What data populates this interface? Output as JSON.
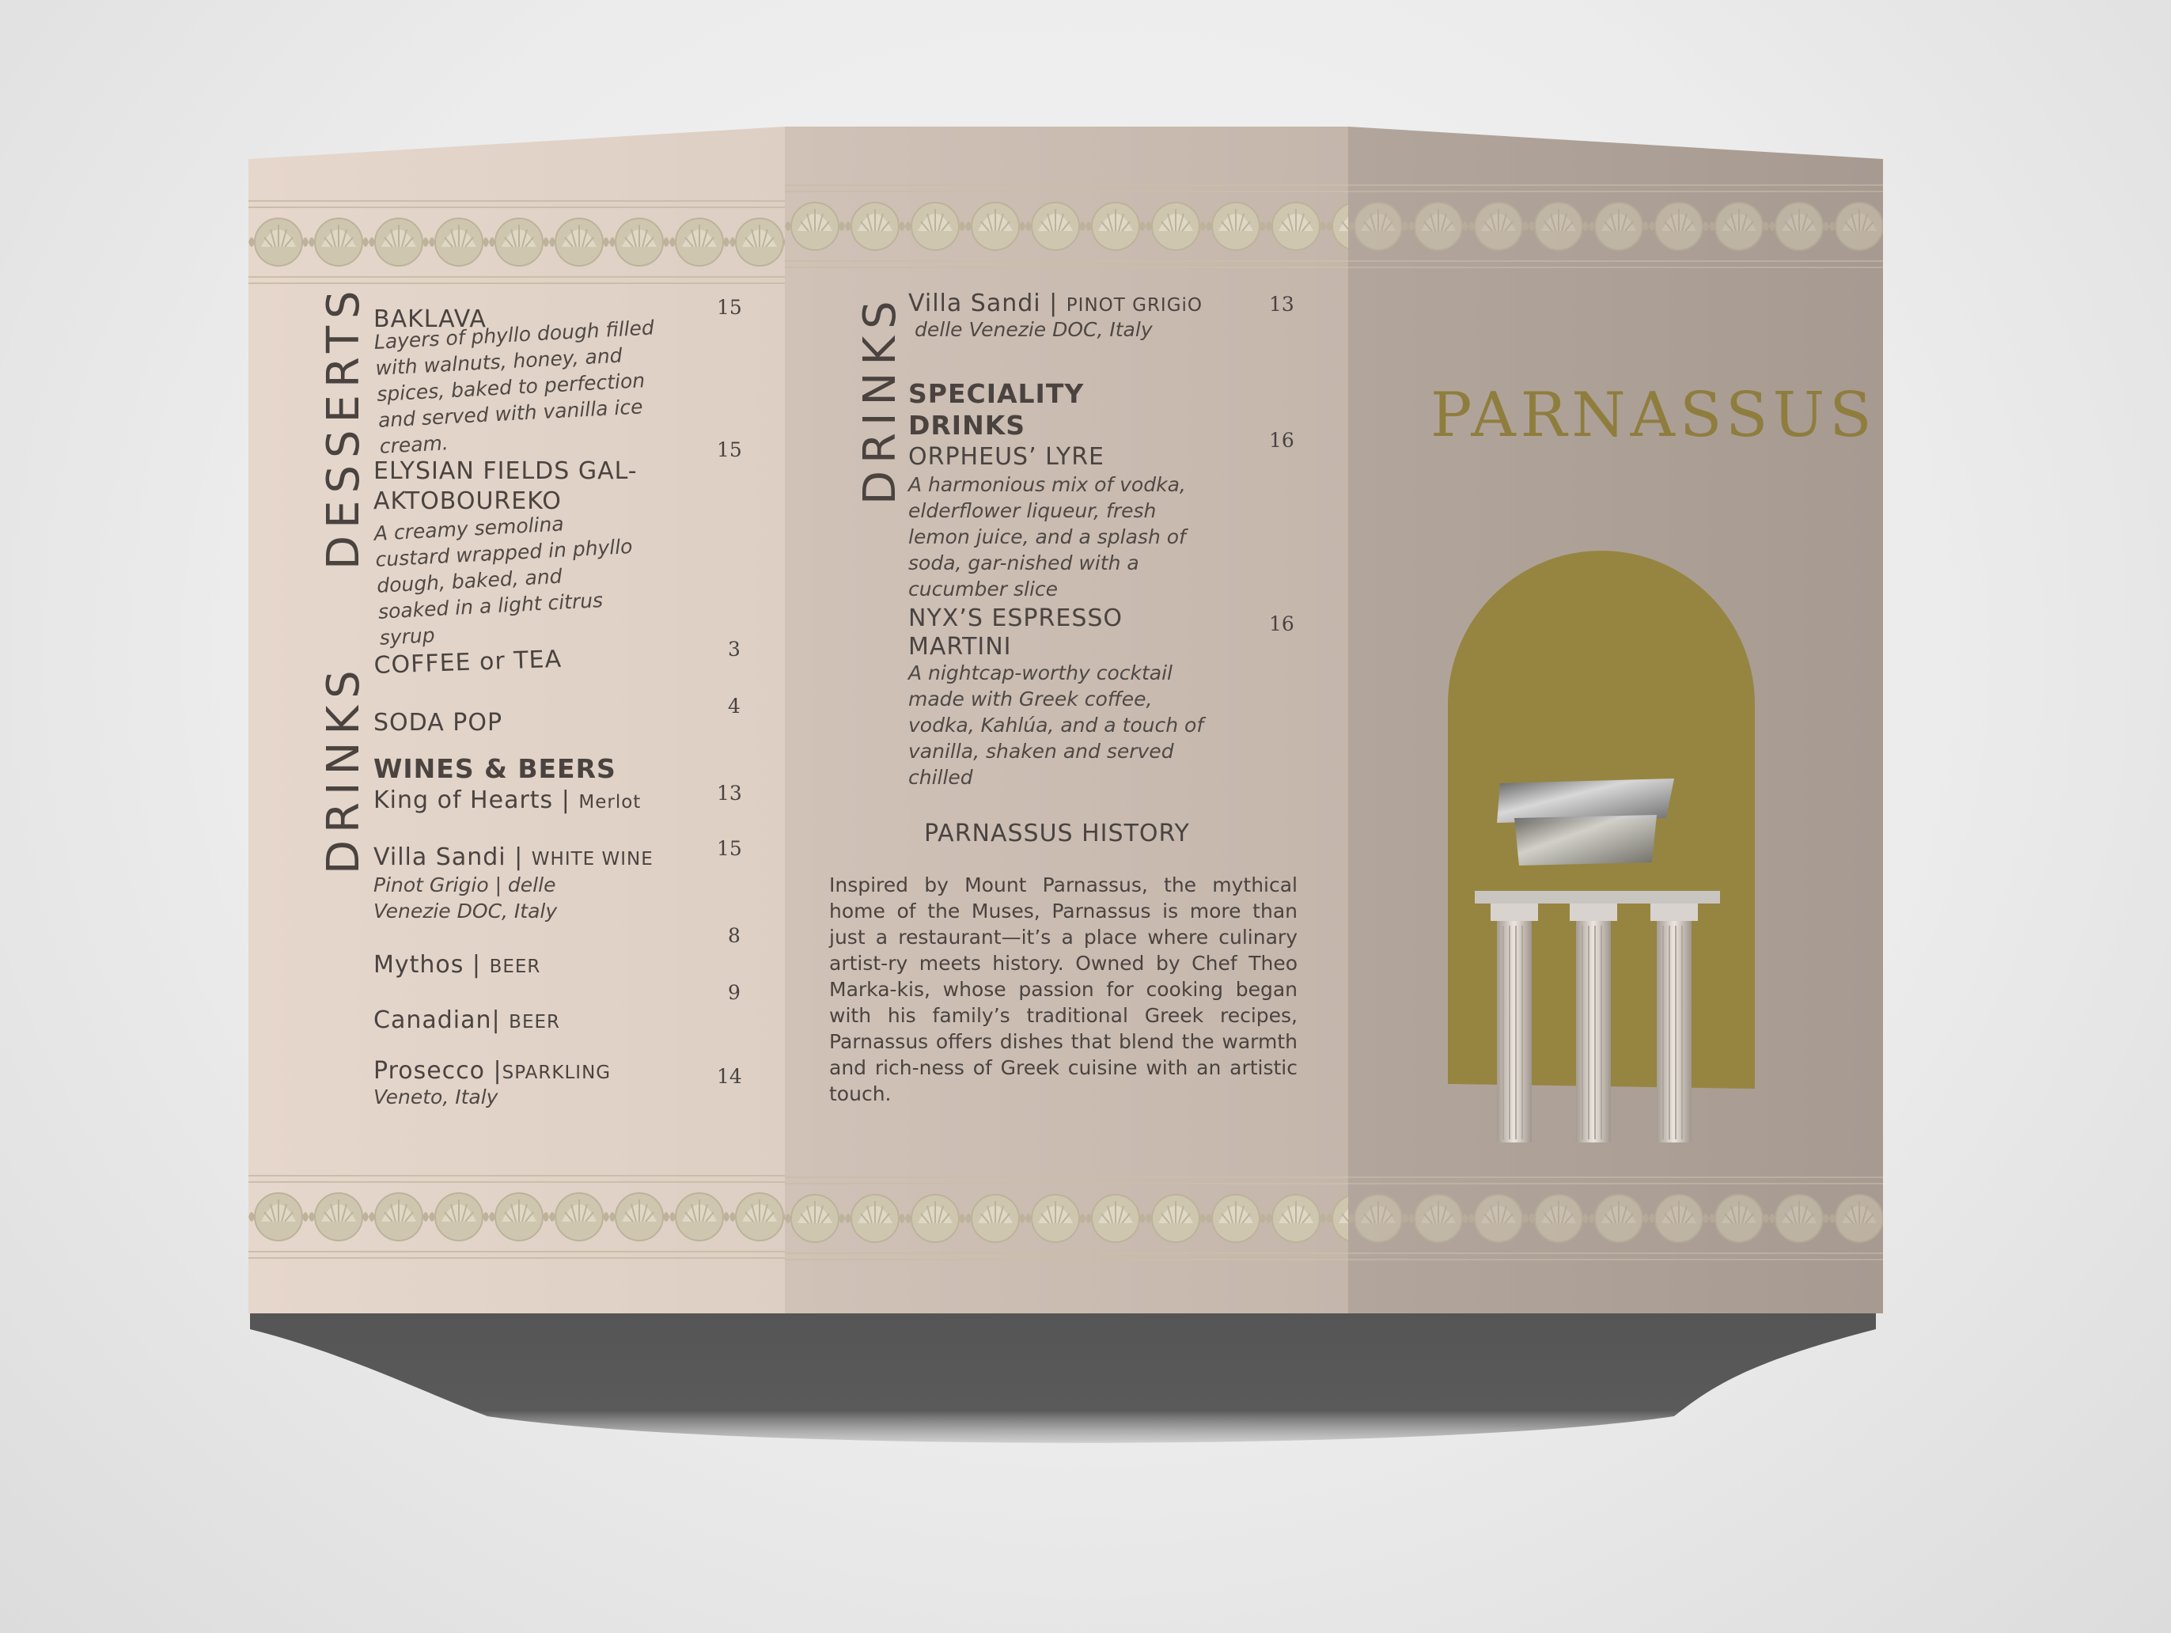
{
  "brand": "PARNASSUS",
  "colors": {
    "gold": "#968540",
    "paper": "#e2d4c8",
    "text": "#4a4340",
    "shadow": "#555555"
  },
  "left_panel": {
    "desserts_heading": "DESSERTS",
    "drinks_heading": "DRINKS",
    "desserts": [
      {
        "name": "BAKLAVA",
        "price": "15",
        "desc": "Layers of phyllo dough filled with walnuts, honey, and spices, baked to perfection and served with vanilla ice cream."
      },
      {
        "name_line1": "ELYSIAN FIELDS GAL-",
        "name_line2": "AKTOBOUREKO",
        "price": "15",
        "desc": "A creamy semolina custard wrapped in phyllo dough, baked, and soaked in a light citrus syrup"
      }
    ],
    "drinks": {
      "coffee": {
        "name": "COFFEE or TEA",
        "price": "3"
      },
      "soda": {
        "name": "SODA POP",
        "price": "4"
      },
      "wines_heading": "WINES & BEERS",
      "king": {
        "name": "King of Hearts |",
        "type": "Merlot",
        "price": "13"
      },
      "villa": {
        "name": "Villa Sandi |",
        "type": "WHITE WINE",
        "price": "15",
        "desc": "Pinot Grigio | delle Venezie DOC, Italy"
      },
      "mythos": {
        "name": "Mythos |",
        "type": "BEER",
        "price": "8"
      },
      "canadian": {
        "name": "Canadian|",
        "type": "BEER",
        "price": "9"
      },
      "prosecco": {
        "name": "Prosecco |",
        "type": "SPARKLING",
        "price": "14",
        "desc": "Veneto, Italy"
      }
    }
  },
  "middle_panel": {
    "drinks_heading": "DRINKS",
    "villa": {
      "name": "Villa Sandi |",
      "type": "PINOT GRIGiO",
      "price": "13",
      "desc": "delle Venezie DOC, Italy"
    },
    "speciality_line1": "SPECIALITY",
    "speciality_line2": "DRINKS",
    "orpheus": {
      "name": "ORPHEUS’ LYRE",
      "price": "16",
      "desc": "A harmonious mix of vodka, elderflower liqueur, fresh lemon juice, and a splash of soda, gar-nished with a cucumber slice"
    },
    "nyx": {
      "name_line1": "NYX’S ESPRESSO",
      "name_line2": "MARTINI",
      "price": "16",
      "desc": "A nightcap-worthy cocktail made with Greek coffee, vodka, Kahlúa, and a touch of vanilla, shaken and served chilled"
    },
    "history_title": "PARNASSUS HISTORY",
    "history_text": "Inspired by Mount Parnassus, the mythical home of the Muses, Parnassus is more than just a restaurant—it’s a place where culinary artist-ry meets history. Owned by Chef Theo Marka-kis, whose passion for cooking began with his family’s traditional Greek recipes, Parnassus offers dishes that blend the warmth and rich-ness of Greek cuisine with an artistic touch."
  },
  "icons": [
    "ornamental-border",
    "temple-columns-illustration",
    "gold-arch"
  ]
}
